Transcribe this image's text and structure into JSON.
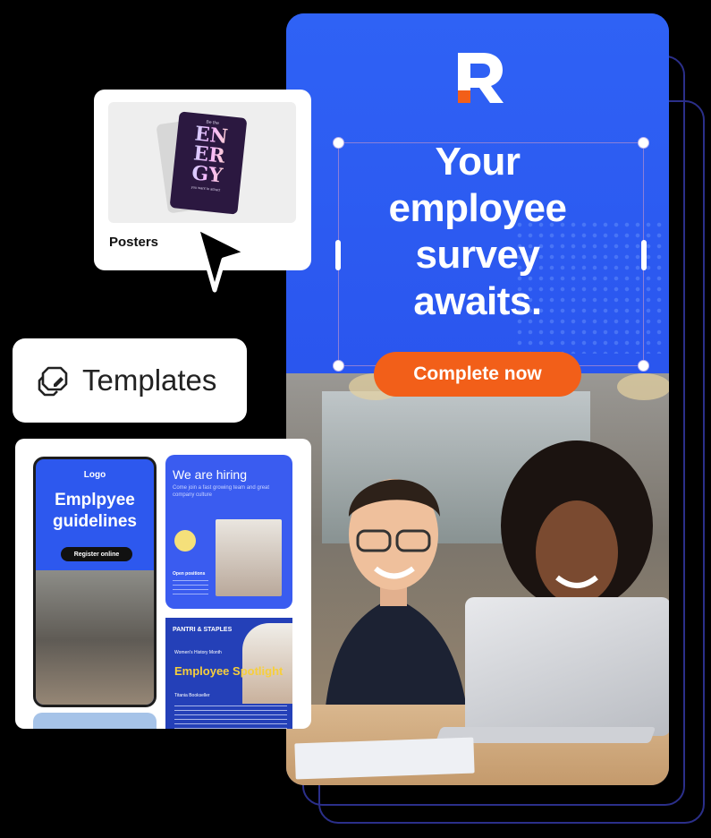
{
  "main_ad": {
    "brand_letter": "R",
    "headline_lines": [
      "Your",
      "employee",
      "survey",
      "awaits."
    ],
    "cta_label": "Complete now",
    "colors": {
      "background": "#2d5cf2",
      "cta": "#f25f19",
      "logo_accent": "#f25f19"
    }
  },
  "posters_card": {
    "label": "Posters",
    "poster": {
      "top_text": "Be the",
      "word": "EN·ER·GY",
      "bottom_text": "you want to attract"
    }
  },
  "templates_chip": {
    "label": "Templates",
    "icon": "templates-icon"
  },
  "templates_panel": {
    "guidelines": {
      "logo": "Logo",
      "title": "Emplpyee guidelines",
      "button": "Register online"
    },
    "hiring": {
      "title": "We are hiring",
      "subtitle": "Come join a fast growing team and great company culture",
      "open_positions": "Open positions"
    },
    "spotlight": {
      "brand": "PANTRI & STAPLES",
      "kicker": "Women's History Month",
      "title": "Employee Spotlight",
      "name": "Titania Bookseller"
    }
  }
}
